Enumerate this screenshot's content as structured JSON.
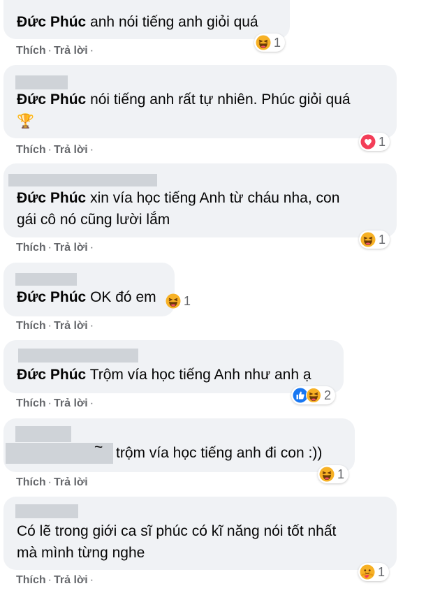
{
  "actions": {
    "like": "Thích",
    "reply": "Trả lời",
    "sep": "·"
  },
  "colors": {
    "bubble": "#f0f2f5",
    "meta_text": "#65676b",
    "haha": "#f7b125",
    "love": "#f33e58",
    "like": "#1877f2"
  },
  "comments": [
    {
      "author": "Đức Phúc",
      "text": "anh nói tiếng anh giỏi quá",
      "reactions": [
        "haha-icon"
      ],
      "count": "1"
    },
    {
      "author": "Đức Phúc",
      "text": "nói tiếng anh rất tự nhiên. Phúc giỏi quá",
      "trophy": "🏆",
      "reactions": [
        "love-icon"
      ],
      "count": "1"
    },
    {
      "author": "Đức Phúc",
      "text": "xin vía học tiếng Anh từ cháu nha, con",
      "text2": "gái cô nó cũng lười lắm",
      "reactions": [
        "haha-icon"
      ],
      "count": "1"
    },
    {
      "author": "Đức Phúc",
      "text": "OK đó em",
      "reactions": [
        "haha-icon"
      ],
      "count": "1"
    },
    {
      "author": "Đức Phúc",
      "text": "Trộm vía học tiếng Anh như anh ạ",
      "reactions": [
        "like-icon",
        "haha-icon"
      ],
      "count": "2"
    },
    {
      "fragment": "~",
      "text": "trộm vía học tiếng anh đi con :))",
      "reactions": [
        "haha-icon"
      ],
      "count": "1"
    },
    {
      "text": "Có lẽ trong giới ca sĩ phúc có kĩ năng nói tốt nhất",
      "text2": "mà mình từng nghe",
      "reactions": [
        "care-icon"
      ],
      "count": "1"
    }
  ]
}
